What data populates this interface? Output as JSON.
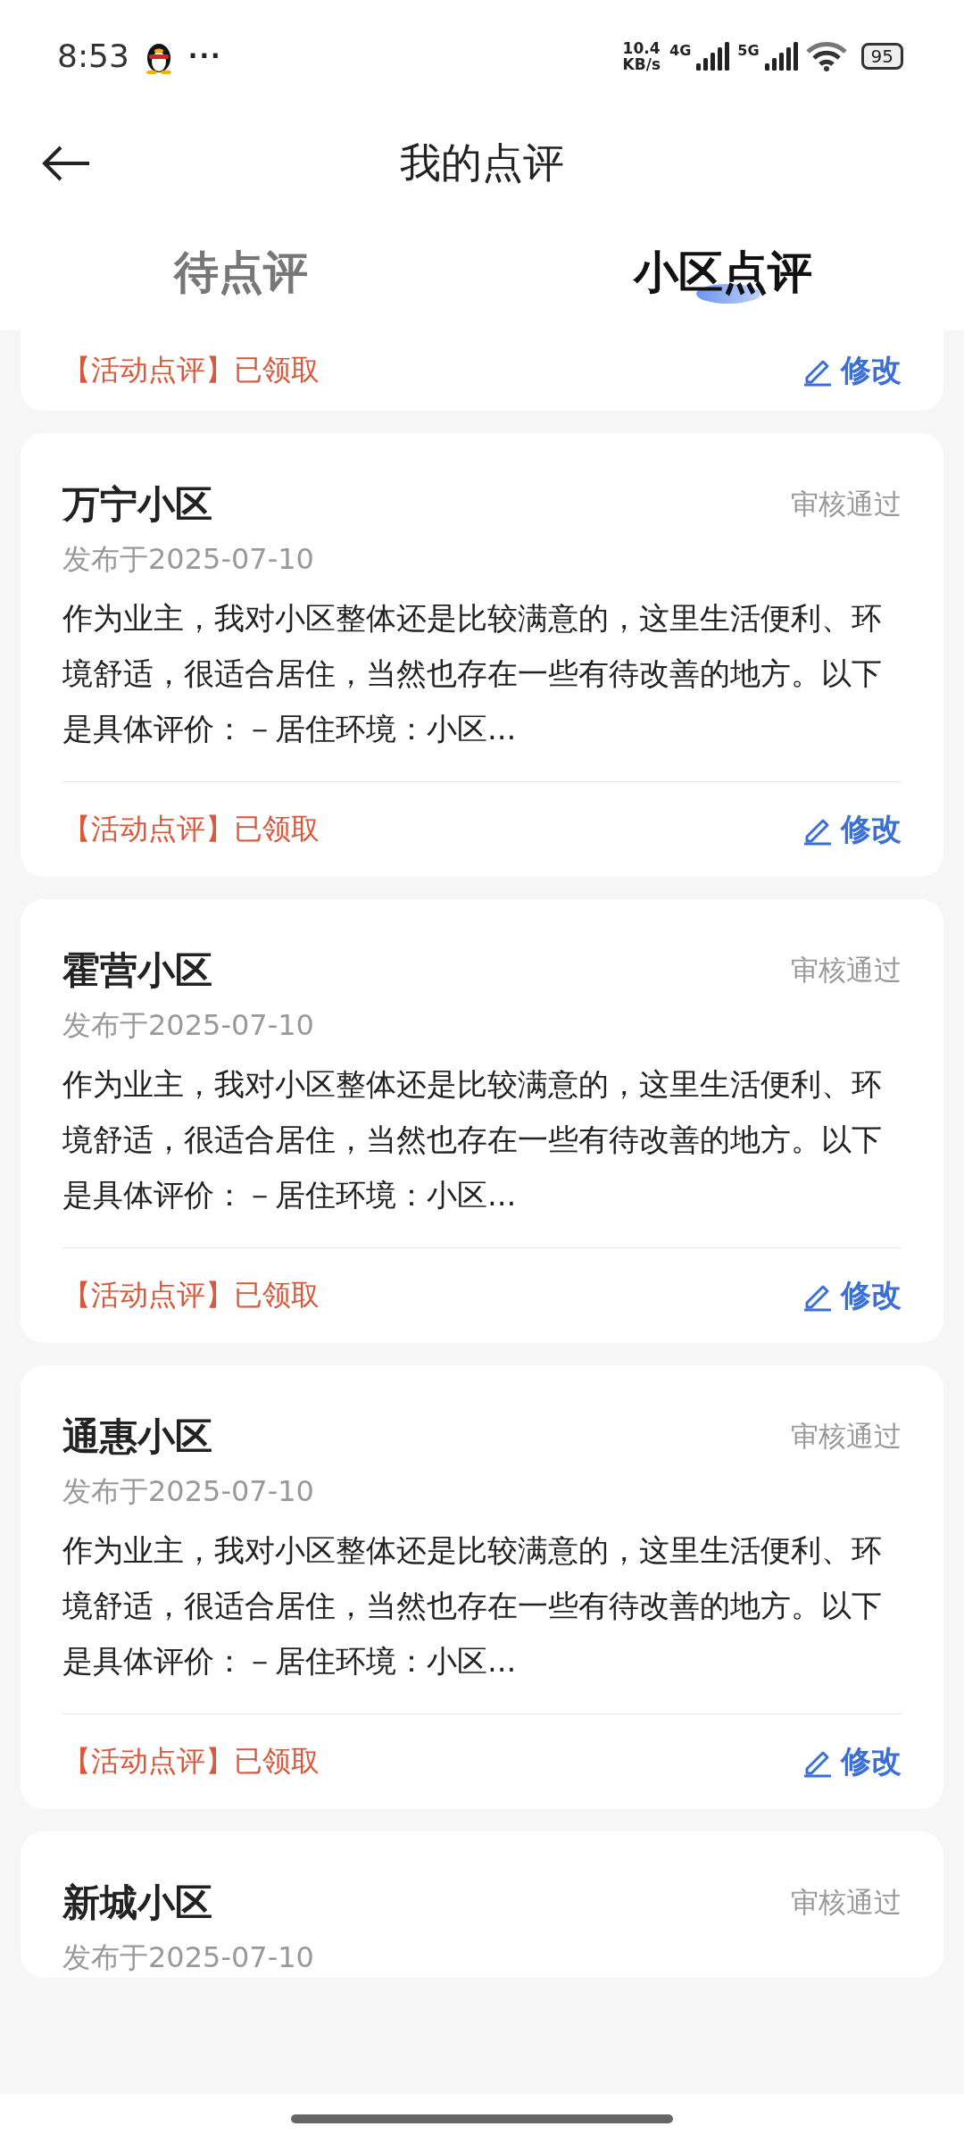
{
  "status_bar": {
    "time": "8:53",
    "more": "···",
    "speed_value": "10.4",
    "speed_unit": "KB/s",
    "net_1": "4G",
    "net_2": "5G",
    "battery": "95"
  },
  "header": {
    "title": "我的点评"
  },
  "tabs": [
    {
      "label": "待点评",
      "selected": false
    },
    {
      "label": "小区点评",
      "selected": true
    }
  ],
  "reviews": [
    {
      "tag": "【活动点评】已领取",
      "edit": "修改"
    },
    {
      "title": "万宁小区",
      "status": "审核通过",
      "date": "发布于2025-07-10",
      "text": "作为业主，我对小区整体还是比较满意的，这里生活便利、环境舒适，很适合居住，当然也存在一些有待改善的地方。以下是具体评价：－居住环境：小区...",
      "tag": "【活动点评】已领取",
      "edit": "修改"
    },
    {
      "title": "霍营小区",
      "status": "审核通过",
      "date": "发布于2025-07-10",
      "text": "作为业主，我对小区整体还是比较满意的，这里生活便利、环境舒适，很适合居住，当然也存在一些有待改善的地方。以下是具体评价：－居住环境：小区...",
      "tag": "【活动点评】已领取",
      "edit": "修改"
    },
    {
      "title": "通惠小区",
      "status": "审核通过",
      "date": "发布于2025-07-10",
      "text": "作为业主，我对小区整体还是比较满意的，这里生活便利、环境舒适，很适合居住，当然也存在一些有待改善的地方。以下是具体评价：－居住环境：小区...",
      "tag": "【活动点评】已领取",
      "edit": "修改"
    },
    {
      "title": "新城小区",
      "status": "审核通过",
      "date": "发布于2025-07-10"
    }
  ]
}
